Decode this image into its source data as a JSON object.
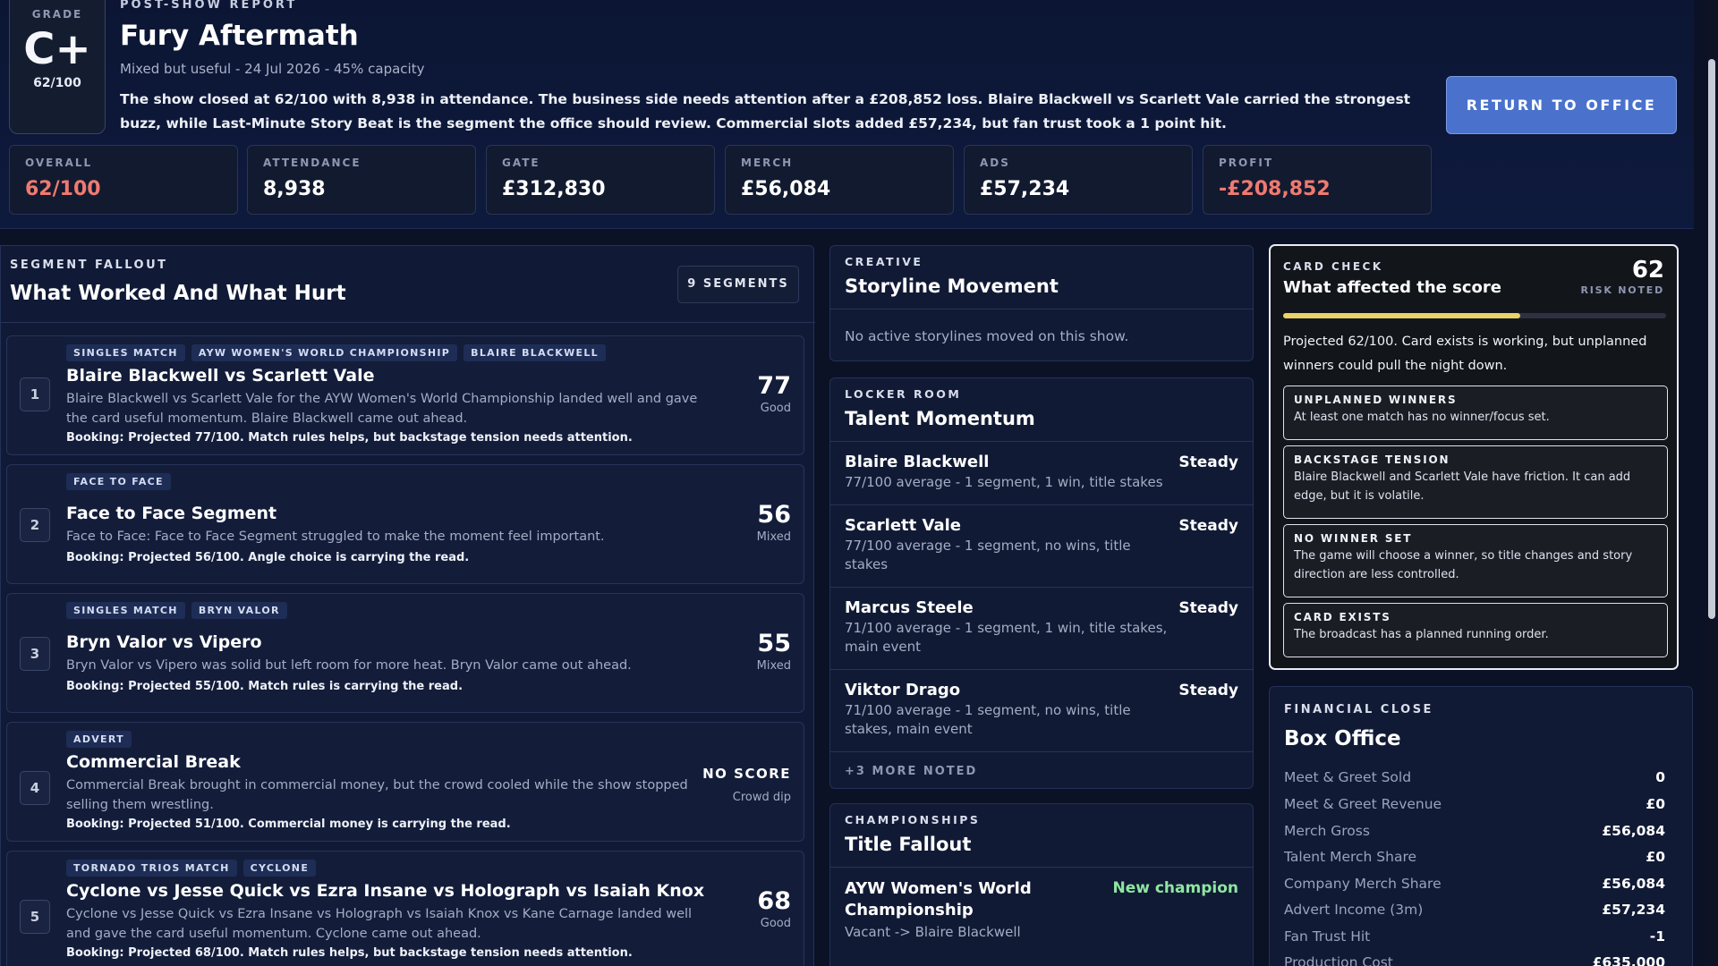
{
  "header": {
    "grade_label": "GRADE",
    "grade": "C+",
    "grade_score": "62/100",
    "report_label": "POST-SHOW REPORT",
    "title": "Fury Aftermath",
    "subtitle": "Mixed but useful - 24 Jul 2026 - 45% capacity",
    "summary": "The show closed at 62/100 with 8,938 in attendance. The business side needs attention after a £208,852 loss. Blaire Blackwell vs Scarlett Vale carried the strongest buzz, while Last-Minute Story Beat is the segment the office should review. Commercial slots added £57,234, but fan trust took a 1 point hit.",
    "return_button": "RETURN TO OFFICE"
  },
  "stats": [
    {
      "label": "OVERALL",
      "value": "62/100"
    },
    {
      "label": "ATTENDANCE",
      "value": "8,938"
    },
    {
      "label": "GATE",
      "value": "£312,830"
    },
    {
      "label": "MERCH",
      "value": "£56,084"
    },
    {
      "label": "ADS",
      "value": "£57,234"
    },
    {
      "label": "PROFIT",
      "value": "-£208,852"
    }
  ],
  "segments": {
    "label": "SEGMENT FALLOUT",
    "title": "What Worked And What Hurt",
    "count": "9 SEGMENTS",
    "items": [
      {
        "num": "1",
        "tags": [
          "SINGLES MATCH",
          "AYW WOMEN'S WORLD CHAMPIONSHIP",
          "BLAIRE BLACKWELL"
        ],
        "title": "Blaire Blackwell vs Scarlett Vale",
        "desc": "Blaire Blackwell vs Scarlett Vale for the AYW Women's World Championship landed well and gave the card useful momentum. Blaire Blackwell came out ahead.",
        "booking": "Booking: Projected 77/100. Match rules helps, but backstage tension needs attention.",
        "score": "77",
        "verdict": "Good"
      },
      {
        "num": "2",
        "tags": [
          "FACE TO FACE"
        ],
        "title": "Face to Face Segment",
        "desc": "Face to Face: Face to Face Segment struggled to make the moment feel important.",
        "booking": "Booking: Projected 56/100. Angle choice is carrying the read.",
        "score": "56",
        "verdict": "Mixed"
      },
      {
        "num": "3",
        "tags": [
          "SINGLES MATCH",
          "BRYN VALOR"
        ],
        "title": "Bryn Valor vs Vipero",
        "desc": "Bryn Valor vs Vipero was solid but left room for more heat. Bryn Valor came out ahead.",
        "booking": "Booking: Projected 55/100. Match rules is carrying the read.",
        "score": "55",
        "verdict": "Mixed"
      },
      {
        "num": "4",
        "tags": [
          "ADVERT"
        ],
        "title": "Commercial Break",
        "desc": "Commercial Break brought in commercial money, but the crowd cooled while the show stopped selling them wrestling.",
        "booking": "Booking: Projected 51/100. Commercial money is carrying the read.",
        "score": "NO SCORE",
        "verdict": "Crowd dip"
      },
      {
        "num": "5",
        "tags": [
          "TORNADO TRIOS MATCH",
          "CYCLONE"
        ],
        "title": "Cyclone vs Jesse Quick vs Ezra Insane vs Holograph vs Isaiah Knox vs Kane...",
        "desc": "Cyclone vs Jesse Quick vs Ezra Insane vs Holograph vs Isaiah Knox vs Kane Carnage landed well and gave the card useful momentum. Cyclone came out ahead.",
        "booking": "Booking: Projected 68/100. Match rules helps, but backstage tension needs attention.",
        "score": "68",
        "verdict": "Good"
      }
    ]
  },
  "storylines": {
    "label": "CREATIVE",
    "title": "Storyline Movement",
    "empty": "No active storylines moved on this show."
  },
  "talent": {
    "label": "LOCKER ROOM",
    "title": "Talent Momentum",
    "items": [
      {
        "name": "Blaire Blackwell",
        "state": "Steady",
        "stat": "77/100 average - 1 segment, 1 win, title stakes"
      },
      {
        "name": "Scarlett Vale",
        "state": "Steady",
        "stat": "77/100 average - 1 segment, no wins, title stakes"
      },
      {
        "name": "Marcus Steele",
        "state": "Steady",
        "stat": "71/100 average - 1 segment, 1 win, title stakes, main event"
      },
      {
        "name": "Viktor Drago",
        "state": "Steady",
        "stat": "71/100 average - 1 segment, no wins, title stakes, main event"
      }
    ],
    "more": "+3 MORE NOTED"
  },
  "titles": {
    "label": "CHAMPIONSHIPS",
    "title": "Title Fallout",
    "items": [
      {
        "name": "AYW Women's World Championship",
        "state": "New champion",
        "change": "Vacant -> Blaire Blackwell"
      }
    ]
  },
  "card_check": {
    "label": "CARD CHECK",
    "title": "What affected the score",
    "score": "62",
    "score_label": "RISK NOTED",
    "progress": 0.62,
    "summary": "Projected 62/100. Card exists is working, but unplanned winners could pull the night down.",
    "items": [
      {
        "label": "UNPLANNED WINNERS",
        "text": "At least one match has no winner/focus set."
      },
      {
        "label": "BACKSTAGE TENSION",
        "text": "Blaire Blackwell and Scarlett Vale have friction. It can add edge, but it is volatile."
      },
      {
        "label": "NO WINNER SET",
        "text": "The game will choose a winner, so title changes and story direction are less controlled."
      },
      {
        "label": "CARD EXISTS",
        "text": "The broadcast has a planned running order."
      }
    ]
  },
  "finance": {
    "label": "FINANCIAL CLOSE",
    "title": "Box Office",
    "rows": [
      {
        "k": "Meet & Greet Sold",
        "v": "0"
      },
      {
        "k": "Meet & Greet Revenue",
        "v": "£0"
      },
      {
        "k": "Merch Gross",
        "v": "£56,084"
      },
      {
        "k": "Talent Merch Share",
        "v": "£0"
      },
      {
        "k": "Company Merch Share",
        "v": "£56,084"
      },
      {
        "k": "Advert Income (3m)",
        "v": "£57,234"
      },
      {
        "k": "Fan Trust Hit",
        "v": "-1"
      },
      {
        "k": "Production Cost",
        "v": "£635,000"
      }
    ]
  },
  "colors": {
    "accent": "#4a72cc",
    "negative": "#f07a70",
    "positive": "#8ee6a0",
    "warning": "#e9d267"
  }
}
